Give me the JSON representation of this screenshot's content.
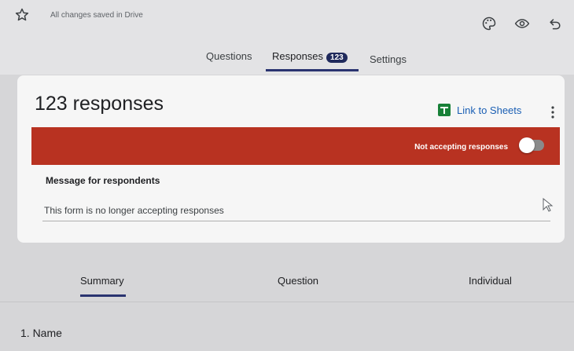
{
  "header": {
    "save_status": "All changes saved in Drive",
    "icons": [
      "star-icon",
      "palette-icon",
      "eye-icon",
      "undo-icon"
    ]
  },
  "tabs": {
    "questions": "Questions",
    "responses": "Responses",
    "responses_count": "123",
    "settings": "Settings"
  },
  "card": {
    "title": "123 responses",
    "link_to_sheets": "Link to Sheets",
    "banner_text": "Not accepting responses",
    "accepting_responses": false,
    "message_label": "Message for respondents",
    "message_value": "This form is no longer accepting responses"
  },
  "section_tabs": {
    "summary": "Summary",
    "question": "Question",
    "individual": "Individual"
  },
  "first_question": "1. Name",
  "colors": {
    "banner": "#b83221",
    "accent": "#2a3470",
    "sheets_green": "#188038",
    "link": "#1a5fb4"
  }
}
